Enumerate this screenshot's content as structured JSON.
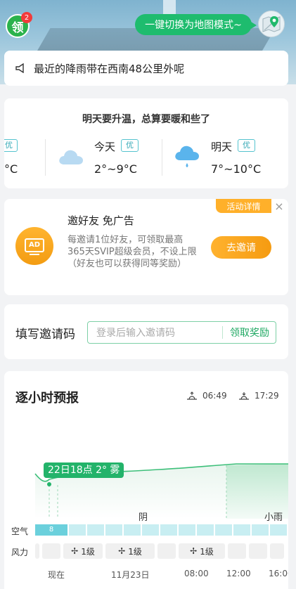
{
  "header": {
    "ling_label": "领",
    "ling_badge": "2",
    "map_mode_label": "一键切换为地图模式~",
    "map_icon": "map-pin-icon"
  },
  "notice": {
    "icon": "speaker-icon",
    "text": "最近的降雨带在西南48公里外呢"
  },
  "daily": {
    "title": "明天要升温，总算要暖和些了",
    "partial": {
      "aqi": "优",
      "temp": "°C"
    },
    "today": {
      "label": "今天",
      "aqi": "优",
      "temp": "2°~9°C",
      "icon": "cloud-icon"
    },
    "tomorrow": {
      "label": "明天",
      "aqi": "优",
      "temp": "7°~10°C",
      "icon": "rain-cloud-icon"
    }
  },
  "promo": {
    "tag": "活动详情",
    "close": "×",
    "icon_text": "AD",
    "title": "邀好友 免广告",
    "desc": "每邀请1位好友，可领取最高365天SVIP超级会员，不设上限（好友也可以获得同等奖励）",
    "button": "去邀请"
  },
  "invite": {
    "label": "填写邀请码",
    "placeholder": "登录后输入邀请码",
    "button": "领取奖励"
  },
  "hourly": {
    "title": "逐小时预报",
    "sunrise": "06:49",
    "sunset": "17:29",
    "callout": "22日18点 2° 雾",
    "weather_yin": "阴",
    "weather_rain": "小雨",
    "air_label": "空气",
    "air_first": "8",
    "wind_label": "风力",
    "wind_items": [
      "1级",
      "1级",
      "1级"
    ],
    "times": [
      "现在",
      "11月23日",
      "08:00",
      "12:00",
      "16:00"
    ]
  },
  "colors": {
    "accent_green": "#1ebc6e",
    "orange": "#f59b11",
    "aqi_blue": "#55c3cf"
  }
}
